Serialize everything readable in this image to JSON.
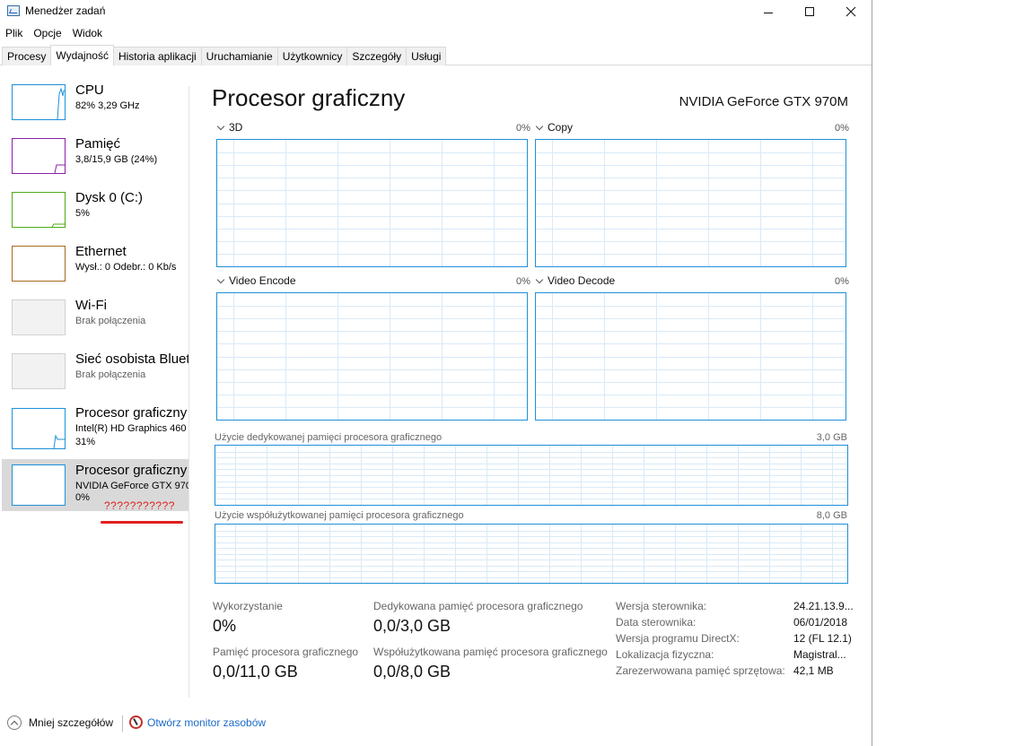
{
  "window": {
    "title": "Menedżer zadań"
  },
  "menu": [
    "Plik",
    "Opcje",
    "Widok"
  ],
  "tabs": [
    {
      "label": "Procesy",
      "active": false
    },
    {
      "label": "Wydajność",
      "active": true
    },
    {
      "label": "Historia aplikacji",
      "active": false
    },
    {
      "label": "Uruchamianie",
      "active": false
    },
    {
      "label": "Użytkownicy",
      "active": false
    },
    {
      "label": "Szczegóły",
      "active": false
    },
    {
      "label": "Usługi",
      "active": false
    }
  ],
  "sidebar": {
    "items": [
      {
        "name": "CPU",
        "sub": "82% 3,29 GHz",
        "color": "#1e90d8"
      },
      {
        "name": "Pamięć",
        "sub": "3,8/15,9 GB (24%)",
        "color": "#8b1fa8"
      },
      {
        "name": "Dysk 0 (C:)",
        "sub": "5%",
        "color": "#4daa14"
      },
      {
        "name": "Ethernet",
        "sub": "Wysł.: 0 Odebr.: 0 Kb/s",
        "color": "#a86a1e"
      },
      {
        "name": "Wi-Fi",
        "sub": "Brak połączenia",
        "color": "#d0d0d0"
      },
      {
        "name": "Sieć osobista Bluet",
        "sub": "Brak połączenia",
        "color": "#d0d0d0"
      },
      {
        "name": "Procesor graficzny",
        "sub": "Intel(R) HD Graphics 460",
        "sub2": "31%",
        "color": "#1e90d8"
      },
      {
        "name": "Procesor graficzny",
        "sub": "NVIDIA GeForce GTX 970",
        "sub2": "0%",
        "color": "#1e90d8"
      }
    ],
    "annotation": "???????????"
  },
  "main": {
    "title": "Procesor graficzny",
    "gpu_name": "NVIDIA GeForce GTX 970M",
    "graphs": [
      {
        "label": "3D",
        "value": "0%"
      },
      {
        "label": "Copy",
        "value": "0%"
      },
      {
        "label": "Video Encode",
        "value": "0%"
      },
      {
        "label": "Video Decode",
        "value": "0%"
      }
    ],
    "dedicated_mem": {
      "label": "Użycie dedykowanej pamięci procesora graficznego",
      "max": "3,0 GB"
    },
    "shared_mem": {
      "label": "Użycie współużytkowanej pamięci procesora graficznego",
      "max": "8,0 GB"
    }
  },
  "stats": {
    "utilization_label": "Wykorzystanie",
    "utilization_value": "0%",
    "dedicated_label": "Dedykowana pamięć procesora graficznego",
    "dedicated_value": "0,0/3,0 GB",
    "gpu_mem_label": "Pamięć procesora graficznego",
    "gpu_mem_value": "0,0/11,0 GB",
    "shared_label": "Współużytkowana pamięć procesora graficznego",
    "shared_value": "0,0/8,0 GB"
  },
  "info": [
    {
      "key": "Wersja sterownika:",
      "value": "24.21.13.9..."
    },
    {
      "key": "Data sterownika:",
      "value": "06/01/2018"
    },
    {
      "key": "Wersja programu DirectX:",
      "value": "12 (FL 12.1)"
    },
    {
      "key": "Lokalizacja fizyczna:",
      "value": "Magistral..."
    },
    {
      "key": "Zarezerwowana pamięć sprzętowa:",
      "value": "42,1 MB"
    }
  ],
  "footer": {
    "less_details": "Mniej szczegółów",
    "open_monitor": "Otwórz monitor zasobów"
  }
}
